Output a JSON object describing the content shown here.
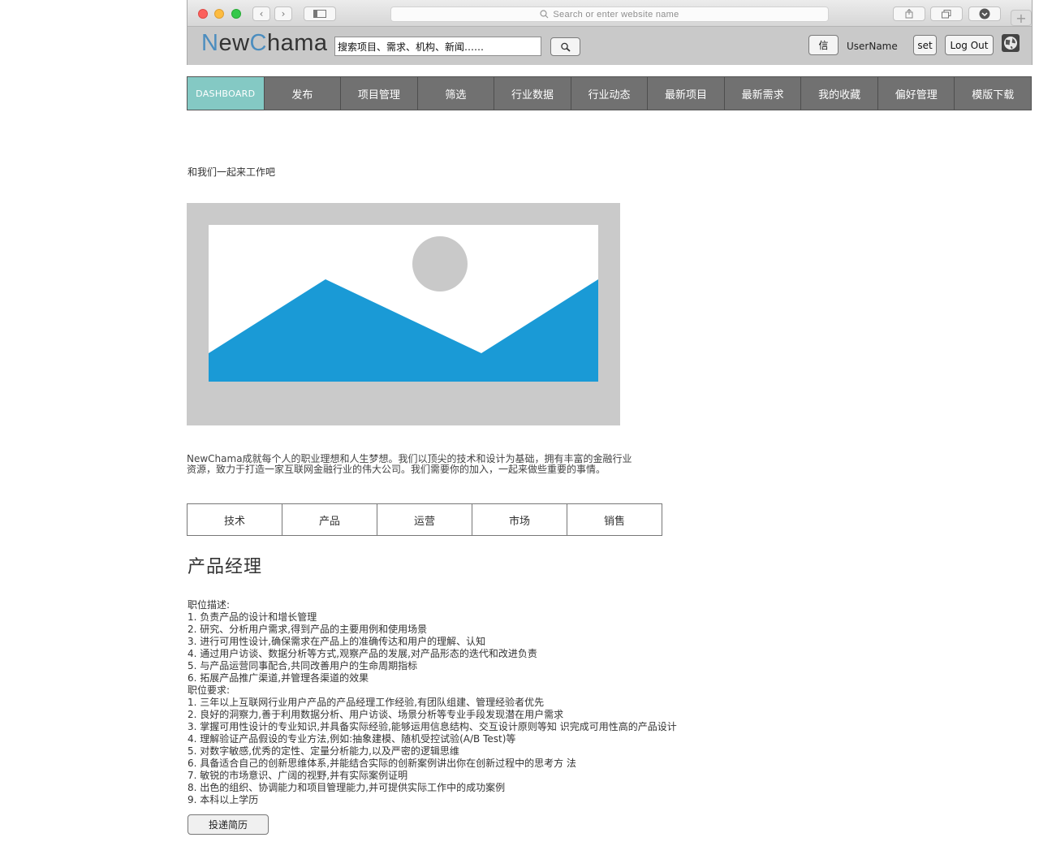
{
  "browser": {
    "address_placeholder": "Search or enter website name",
    "back_glyph": "‹",
    "forward_glyph": "›",
    "add_tab_glyph": "+"
  },
  "header": {
    "logo_prefix": "N",
    "logo_mid": "ew",
    "logo_c": "C",
    "logo_suffix": "hama",
    "search_value": "搜索项目、需求、机构、新闻……",
    "message_label": "信",
    "username": "UserName",
    "settings_label": "set",
    "logout_label": "Log Out"
  },
  "nav": {
    "items": [
      "DASHBOARD",
      "发布",
      "项目管理",
      "筛选",
      "行业数据",
      "行业动态",
      "最新项目",
      "最新需求",
      "我的收藏",
      "偏好管理",
      "模版下载"
    ],
    "active_index": 0,
    "active_color": "#84c9c4"
  },
  "main": {
    "tagline": "和我们一起来工作吧",
    "intro_line1": "NewChama成就每个人的职业理想和人生梦想。我们以顶尖的技术和设计为基础，拥有丰富的金融行业",
    "intro_line2": "资源，致力于打造一家互联网金融行业的伟大公司。我们需要你的加入，一起来做些重要的事情。",
    "categories": [
      "技术",
      "产品",
      "运营",
      "市场",
      "销售"
    ],
    "job_title": "产品经理",
    "duty_heading": "职位描述:",
    "duties": [
      "1. 负责产品的设计和增长管理",
      "2. 研究、分析用户需求,得到产品的主要用例和使用场景",
      "3. 进行可用性设计,确保需求在产品上的准确传达和用户的理解、认知",
      "4. 通过用户访谈、数据分析等方式,观察产品的发展,对产品形态的迭代和改进负责",
      "5. 与产品运营同事配合,共同改善用户的生命周期指标",
      "6. 拓展产品推广渠道,并管理各渠道的效果"
    ],
    "req_heading": "职位要求:",
    "requirements": [
      "1. 三年以上互联网行业用户产品的产品经理工作经验,有团队组建、管理经验者优先",
      "2. 良好的洞察力,善于利用数据分析、用户访谈、场景分析等专业手段发现潜在用户需求",
      "3. 掌握可用性设计的专业知识,并具备实际经验,能够运用信息结构、交互设计原则等知 识完成可用性高的产品设计",
      "4. 理解验证产品假设的专业方法,例如:抽象建模、随机受控试验(A/B Test)等",
      "5. 对数字敏感,优秀的定性、定量分析能力,以及严密的逻辑思维",
      "6. 具备适合自己的创新思维体系,并能结合实际的创新案例讲出你在创新过程中的思考方 法",
      "7. 敏锐的市场意识、广阔的视野,并有实际案例证明",
      "8. 出色的组织、协调能力和项目管理能力,并可提供实际工作中的成功案例",
      "9. 本科以上学历"
    ],
    "apply_label": "投递简历"
  },
  "colors": {
    "placeholder_bg": "#cacaca",
    "mountain": "#1a9ad6",
    "sun": "#c9c9c9",
    "nav_bg": "#717171"
  }
}
